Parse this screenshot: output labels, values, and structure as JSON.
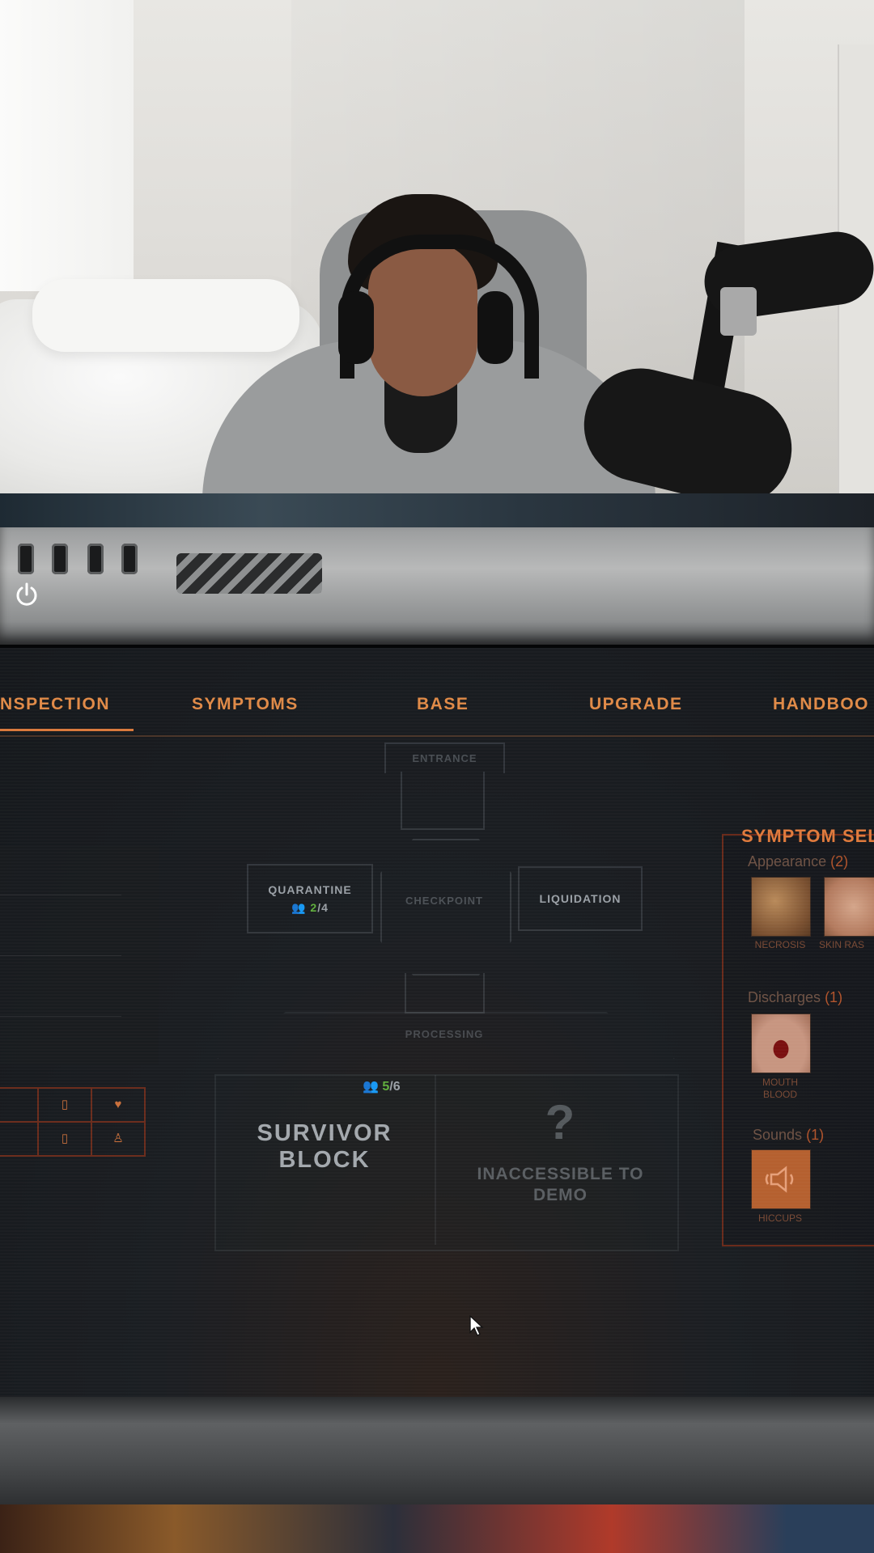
{
  "tabs": {
    "inspection": "NSPECTION",
    "symptoms": "SYMPTOMS",
    "base": "BASE",
    "upgrade": "UPGRADE",
    "handbook": "HANDBOO"
  },
  "map": {
    "entrance": "ENTRANCE",
    "checkpoint": "CHECKPOINT",
    "quarantine": "QUARANTINE",
    "quarantine_occupied": "2",
    "quarantine_capacity": "/4",
    "liquidation": "LIQUIDATION",
    "processing": "PROCESSING",
    "survivor_occupied": "5",
    "survivor_capacity": "/6",
    "survivor_line1": "SURVIVOR",
    "survivor_line2": "BLOCK",
    "locked_mark": "?",
    "locked_line1": "INACCESSIBLE TO",
    "locked_line2": "DEMO"
  },
  "symptom_panel": {
    "title": "SYMPTOM SEL",
    "appearance_label": "Appearance",
    "appearance_count": "(2)",
    "appearance_items": [
      "NECROSIS",
      "SKIN RAS"
    ],
    "discharges_label": "Discharges",
    "discharges_count": "(1)",
    "discharges_items": [
      "MOUTH",
      "BLOOD"
    ],
    "sounds_label": "Sounds",
    "sounds_count": "(1)",
    "sounds_items": [
      "HICCUPS"
    ]
  },
  "colors": {
    "accent": "#e08a47",
    "occupied_green": "#5fae3c",
    "panel_border": "#6a2b1b"
  },
  "icons": [
    "power-icon",
    "people-icon",
    "speaker-icon",
    "cursor-icon"
  ]
}
